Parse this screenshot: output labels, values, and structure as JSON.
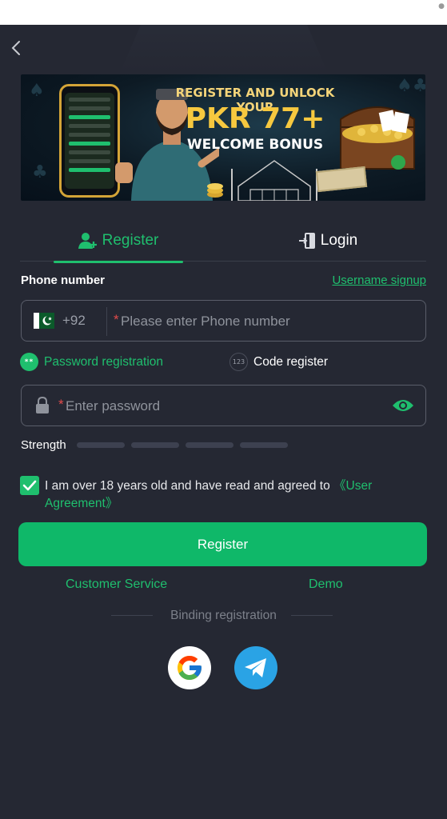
{
  "banner": {
    "line1": "REGISTER AND UNLOCK YOUR",
    "line2": "PKR 77+",
    "line3": "WELCOME BONUS"
  },
  "tabs": {
    "register_label": "Register",
    "login_label": "Login"
  },
  "form": {
    "phone_label": "Phone number",
    "username_signup_link": "Username signup",
    "country_code": "+92",
    "phone_required_mark": "*",
    "phone_placeholder": "Please enter Phone number",
    "password_registration_label": "Password registration",
    "password_badge_text": "**",
    "code_register_label": "Code register",
    "code_badge_text": "123",
    "password_required_mark": "*",
    "password_placeholder": "Enter password",
    "strength_label": "Strength",
    "strength_level": 0,
    "agree_checked": true,
    "agree_text": "I am over 18 years old and have read and agreed to ",
    "agree_link": "《User Agreement》"
  },
  "actions": {
    "register_button": "Register",
    "customer_service": "Customer Service",
    "demo": "Demo",
    "binding_registration": "Binding registration"
  },
  "icons": {
    "back": "chevron-left-icon",
    "register_tab": "user-plus-icon",
    "login_tab": "login-door-icon",
    "flag": "pakistan-flag-icon",
    "lock": "lock-icon",
    "eye": "eye-icon",
    "checkbox": "check-icon",
    "google": "google-icon",
    "telegram": "telegram-icon"
  },
  "colors": {
    "accent": "#1fbf6e",
    "background": "#252833",
    "button": "#0fb869",
    "required": "#e34b4b"
  }
}
